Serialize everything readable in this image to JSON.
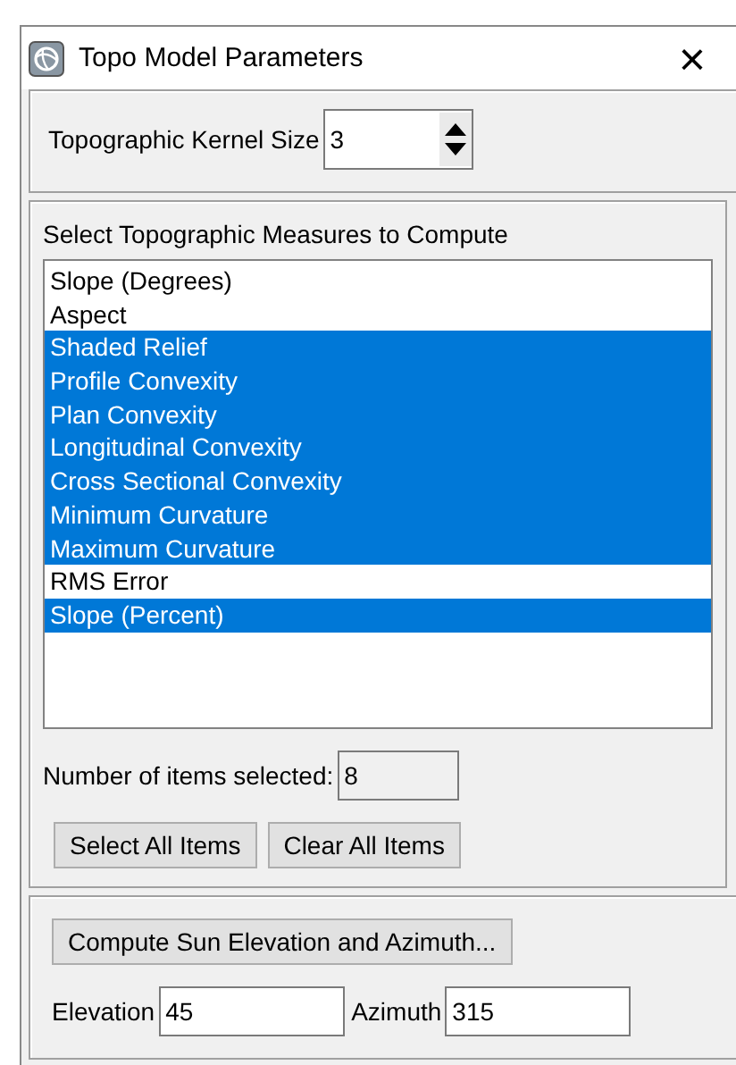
{
  "window": {
    "title": "Topo Model Parameters",
    "close": "×"
  },
  "kernel": {
    "label": "Topographic Kernel Size",
    "value": "3"
  },
  "measures": {
    "title": "Select Topographic Measures to Compute",
    "items": [
      {
        "label": "Slope (Degrees)",
        "selected": false
      },
      {
        "label": "Aspect",
        "selected": false
      },
      {
        "label": "Shaded Relief",
        "selected": true
      },
      {
        "label": "Profile Convexity",
        "selected": true
      },
      {
        "label": "Plan Convexity",
        "selected": true
      },
      {
        "label": "Longitudinal Convexity",
        "selected": true
      },
      {
        "label": "Cross Sectional Convexity",
        "selected": true
      },
      {
        "label": "Minimum Curvature",
        "selected": true
      },
      {
        "label": "Maximum Curvature",
        "selected": true
      },
      {
        "label": "RMS Error",
        "selected": false
      },
      {
        "label": "Slope (Percent)",
        "selected": true
      }
    ],
    "count_label": "Number of items selected:",
    "count": "8",
    "buttons": [
      "Select All Items",
      "Clear All Items"
    ]
  },
  "sun": {
    "button": "Compute Sun Elevation and Azimuth...",
    "elevation_label": "Elevation",
    "elevation": "45",
    "azimuth_label": "Azimuth",
    "azimuth": "315"
  }
}
